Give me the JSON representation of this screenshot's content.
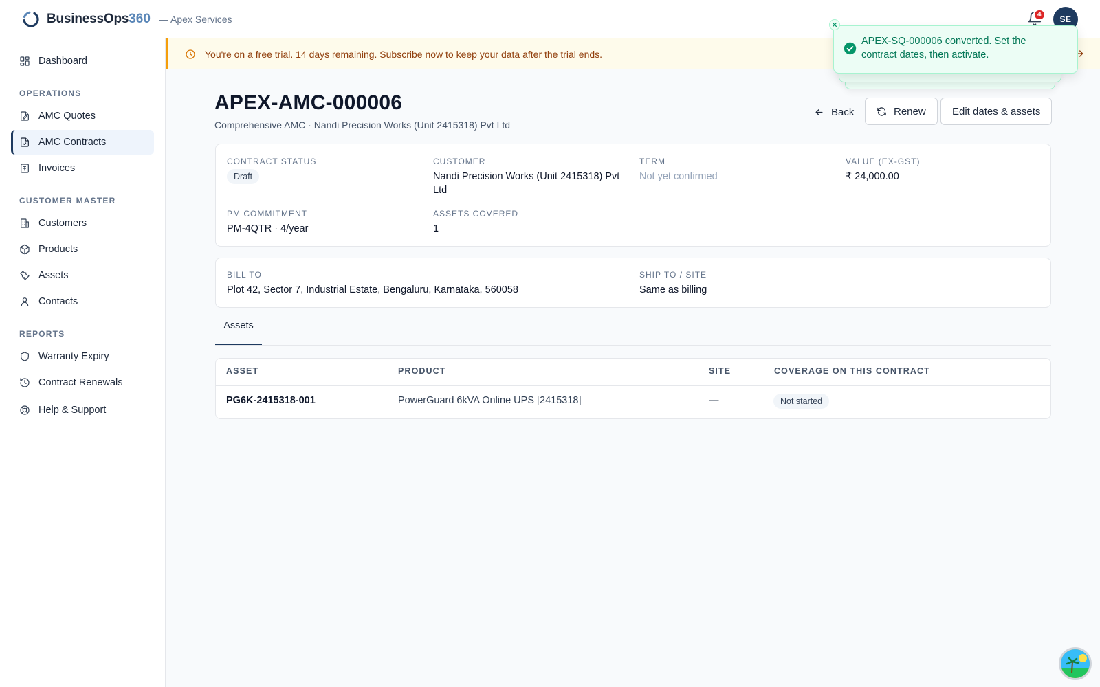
{
  "app": {
    "brand_name": "BusinessOps",
    "brand_number": "360",
    "org": "— Apex Services",
    "notification_count": "4",
    "avatar_initials": "SE"
  },
  "sidebar": {
    "top_item": {
      "label": "Dashboard",
      "icon": "dashboard-icon"
    },
    "sections": {
      "operations": "OPERATIONS",
      "customer_master": "CUSTOMER MASTER",
      "reports": "REPORTS"
    },
    "operations": [
      {
        "label": "AMC Quotes",
        "icon": "quote-icon"
      },
      {
        "label": "AMC Contracts",
        "icon": "contract-icon",
        "active": true
      },
      {
        "label": "Invoices",
        "icon": "invoice-icon"
      }
    ],
    "customer_master": [
      {
        "label": "Customers",
        "icon": "building-icon"
      },
      {
        "label": "Products",
        "icon": "box-icon"
      },
      {
        "label": "Assets",
        "icon": "wrench-icon"
      },
      {
        "label": "Contacts",
        "icon": "user-icon"
      }
    ],
    "reports": [
      {
        "label": "Warranty Expiry",
        "icon": "shield-icon"
      },
      {
        "label": "Contract Renewals",
        "icon": "history-icon"
      },
      {
        "label": "Help & Support",
        "icon": "lifebuoy-icon"
      }
    ]
  },
  "banner": {
    "text": "You're on a free trial. 14 days remaining. Subscribe now to keep your data after the trial ends."
  },
  "toast": {
    "message": "APEX-SQ-000006 converted. Set the contract dates, then activate."
  },
  "page": {
    "title": "APEX-AMC-000006",
    "subtitle": "Comprehensive AMC · Nandi Precision Works (Unit 2415318) Pvt Ltd",
    "back_label": "Back",
    "renew_label": "Renew",
    "edit_label": "Edit dates & assets"
  },
  "summary": {
    "contract_status_label": "CONTRACT STATUS",
    "contract_status": "Draft",
    "customer_label": "CUSTOMER",
    "customer": "Nandi Precision Works (Unit 2415318) Pvt Ltd",
    "term_label": "TERM",
    "term": "Not yet confirmed",
    "value_label": "VALUE (EX-GST)",
    "value": "₹ 24,000.00",
    "pm_label": "PM COMMITMENT",
    "pm": "PM-4QTR · 4/year",
    "assets_covered_label": "ASSETS COVERED",
    "assets_covered": "1"
  },
  "address": {
    "bill_to_label": "BILL TO",
    "bill_to": "Plot 42, Sector 7, Industrial Estate, Bengaluru, Karnataka, 560058",
    "ship_to_label": "SHIP TO / SITE",
    "ship_to": "Same as billing"
  },
  "tabs": [
    {
      "label": "Assets",
      "active": true
    }
  ],
  "assets_table": {
    "columns": [
      "ASSET",
      "PRODUCT",
      "SITE",
      "COVERAGE ON THIS CONTRACT"
    ],
    "rows": [
      {
        "asset": "PG6K-2415318-001",
        "product": "PowerGuard 6kVA Online UPS [2415318]",
        "site": "—",
        "coverage": "Not started"
      }
    ]
  },
  "colors": {
    "brand_navy": "#1e3a5f",
    "brand_blue": "#5b87b8",
    "banner_bg": "#fefbeb",
    "banner_accent": "#f59e0b",
    "toast_bg": "#ecfdf5",
    "toast_text": "#047857",
    "badge_red": "#dc2626"
  }
}
